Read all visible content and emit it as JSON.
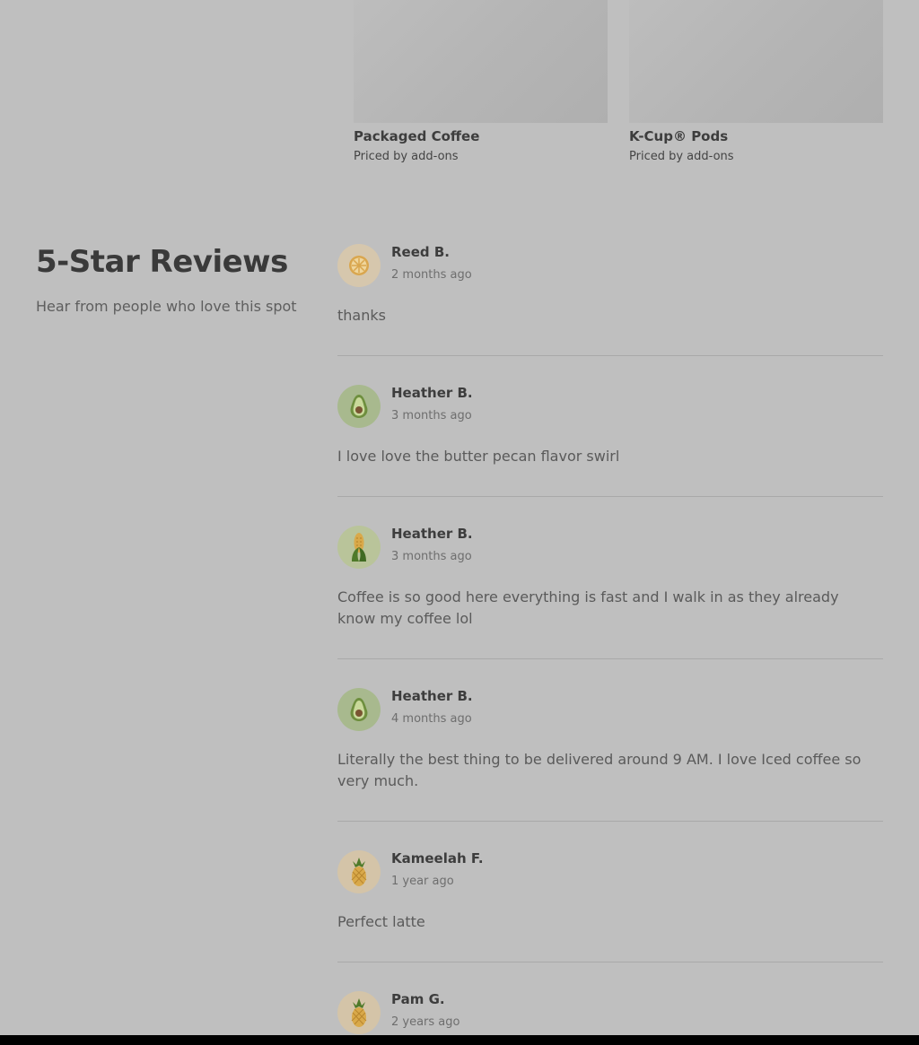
{
  "products": [
    {
      "name": "Packaged Coffee",
      "price": "Priced by add-ons"
    },
    {
      "name": "K-Cup® Pods",
      "price": "Priced by add-ons"
    }
  ],
  "reviews_section": {
    "title": "5-Star Reviews",
    "subtitle": "Hear from people who love this spot"
  },
  "reviews": [
    {
      "author": "Reed B.",
      "date": "2 months ago",
      "text": "thanks",
      "avatar_icon": "orange-slice-icon"
    },
    {
      "author": "Heather B.",
      "date": "3 months ago",
      "text": "I love love the butter pecan flavor swirl",
      "avatar_icon": "avocado-icon"
    },
    {
      "author": "Heather B.",
      "date": "3 months ago",
      "text": "Coffee is so good here everything is fast and I walk in as they already know my coffee lol",
      "avatar_icon": "corn-icon"
    },
    {
      "author": "Heather B.",
      "date": "4 months ago",
      "text": "Literally the best thing to be delivered around 9 AM. I love Iced coffee so very much.",
      "avatar_icon": "avocado-icon"
    },
    {
      "author": "Kameelah F.",
      "date": "1 year ago",
      "text": "Perfect latte",
      "avatar_icon": "pineapple-icon"
    },
    {
      "author": "Pam G.",
      "date": "2 years ago",
      "text": "",
      "avatar_icon": "pineapple-icon"
    }
  ],
  "colors": {
    "overlay_background": "#bfbfbf",
    "avatar_orange_bg": "#d6c7ad",
    "avatar_avocado_bg": "#a8b98e",
    "avatar_corn_bg": "#b9c49a",
    "avatar_pineapple_bg": "#d4c4a8"
  }
}
